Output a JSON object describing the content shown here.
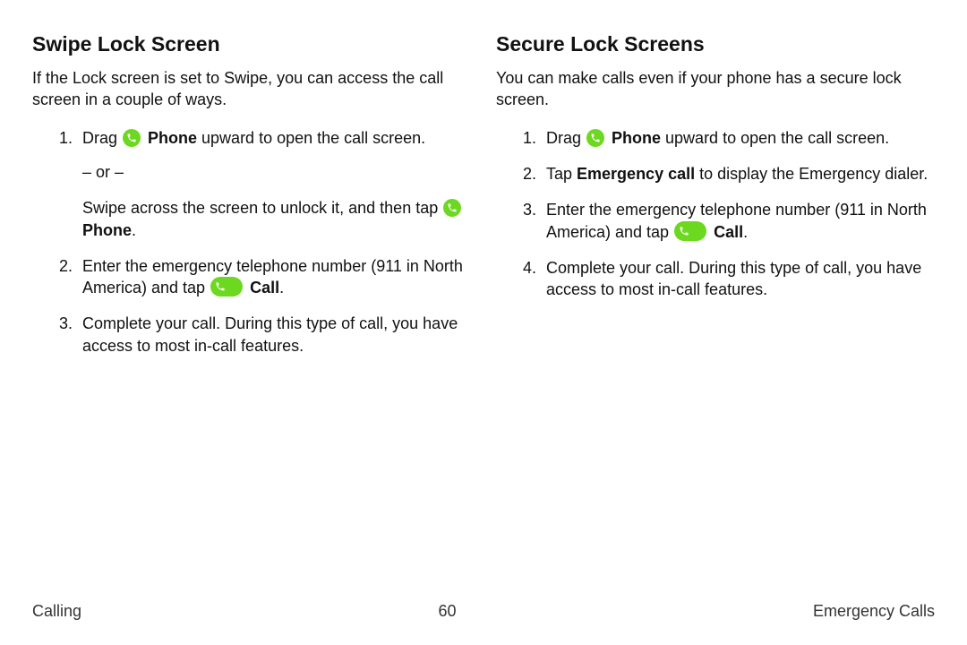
{
  "left": {
    "heading": "Swipe Lock Screen",
    "intro": "If the Lock screen is set to Swipe, you can access the call screen in a couple of ways.",
    "step1_pre": "Drag ",
    "step1_bold": " Phone",
    "step1_post": " upward to open the call screen.",
    "or": "– or –",
    "step1b_pre": "Swipe across the screen to unlock it, and then tap ",
    "step1b_bold": " Phone",
    "step1b_post": ".",
    "step2_pre": "Enter the emergency telephone number (911 in North America) and tap ",
    "step2_bold": " Call",
    "step2_post": ".",
    "step3": "Complete your call. During this type of call, you have access to most in-call features."
  },
  "right": {
    "heading": "Secure Lock Screens",
    "intro": "You can make calls even if your phone has a secure lock screen.",
    "step1_pre": "Drag ",
    "step1_bold": " Phone",
    "step1_post": " upward to open the call screen.",
    "step2_pre": "Tap ",
    "step2_bold": "Emergency call",
    "step2_post": " to display the Emergency dialer.",
    "step3_pre": "Enter the emergency telephone number (911 in North America) and tap ",
    "step3_bold": " Call",
    "step3_post": ".",
    "step4": "Complete your call. During this type of call, you have access to most in-call features."
  },
  "footer": {
    "left": "Calling",
    "center": "60",
    "right": "Emergency Calls"
  }
}
